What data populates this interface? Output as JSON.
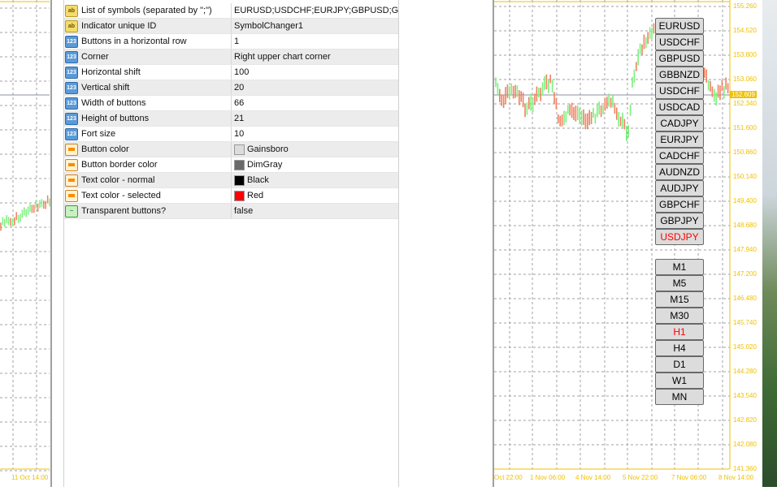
{
  "properties": [
    {
      "icon": "ab",
      "name": "List of symbols (separated by \";\")",
      "value": "EURUSD;USDCHF;EURJPY;GBPUSD;GBP..."
    },
    {
      "icon": "ab",
      "name": "Indicator unique ID",
      "value": "SymbolChanger1"
    },
    {
      "icon": "n",
      "name": "Buttons in a horizontal row",
      "value": "1"
    },
    {
      "icon": "n",
      "name": "Corner",
      "value": "Right upper chart corner"
    },
    {
      "icon": "n",
      "name": "Horizontal shift",
      "value": "100"
    },
    {
      "icon": "n",
      "name": "Vertical shift",
      "value": "20"
    },
    {
      "icon": "n",
      "name": "Width of buttons",
      "value": "66"
    },
    {
      "icon": "n",
      "name": "Height of buttons",
      "value": "21"
    },
    {
      "icon": "n",
      "name": "Fort size",
      "value": "10"
    },
    {
      "icon": "c",
      "name": "Button color",
      "value": "Gainsboro",
      "swatch": "#dcdcdc"
    },
    {
      "icon": "c",
      "name": "Button border color",
      "value": "DimGray",
      "swatch": "#696969"
    },
    {
      "icon": "c",
      "name": "Text color - normal",
      "value": "Black",
      "swatch": "#000000"
    },
    {
      "icon": "c",
      "name": "Text color - selected",
      "value": "Red",
      "swatch": "#ff0000"
    },
    {
      "icon": "b",
      "name": "Transparent buttons?",
      "value": "false"
    }
  ],
  "symbols": [
    "EURUSD",
    "USDCHF",
    "GBPUSD",
    "GBBNZD",
    "USDCHF",
    "USDCAD",
    "CADJPY",
    "EURJPY",
    "CADCHF",
    "AUDNZD",
    "AUDJPY",
    "GBPCHF",
    "GBPJPY",
    "USDJPY"
  ],
  "selected_symbol": "USDJPY",
  "timeframes": [
    "M1",
    "M5",
    "M15",
    "M30",
    "H1",
    "H4",
    "D1",
    "W1",
    "MN"
  ],
  "selected_timeframe": "H1",
  "chart": {
    "price_labels": [
      "155.260",
      "154.520",
      "153.800",
      "153.060",
      "152.340",
      "151.600",
      "150.860",
      "150.140",
      "149.400",
      "148.680",
      "147.940",
      "147.200",
      "146.480",
      "145.740",
      "145.020",
      "144.280",
      "143.540",
      "142.820",
      "142.080",
      "141.360"
    ],
    "current_price": "152.609",
    "time_labels": [
      "Oct 22:00",
      "1 Nov 06:00",
      "4 Nov 14:00",
      "5 Nov 22:00",
      "7 Nov 06:00",
      "8 Nov 14:00"
    ],
    "left_time_label": "11 Oct 14:00",
    "colors": {
      "bull": "#7cf07c",
      "bear": "#f08060",
      "axis": "#f0c000",
      "grid": "#a0a0a8"
    }
  }
}
